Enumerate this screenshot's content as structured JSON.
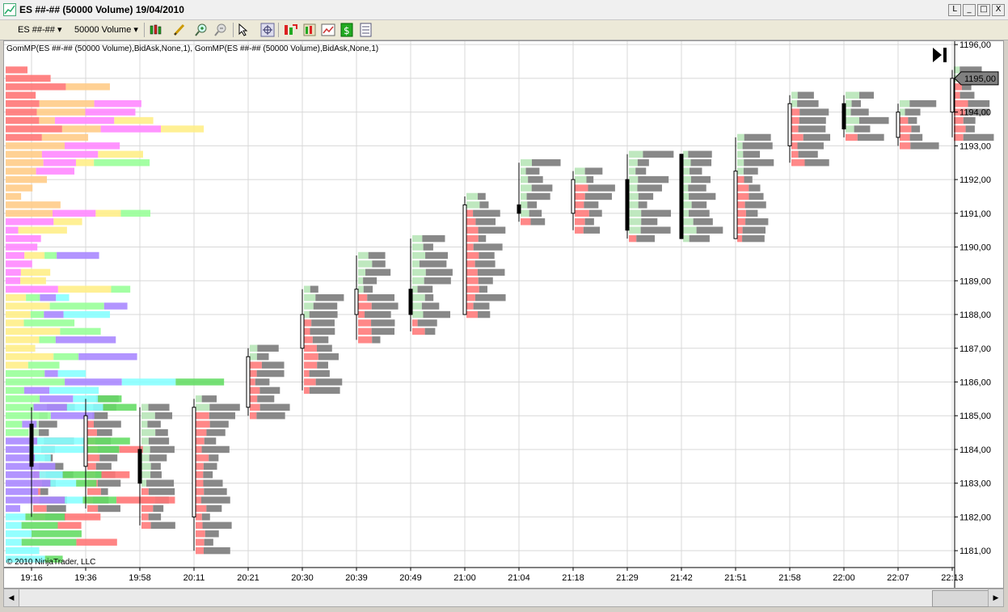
{
  "window": {
    "title": "ES ##-## (50000 Volume)  19/04/2010",
    "buttons": [
      "L",
      "_",
      "□",
      "X"
    ]
  },
  "toolbar": {
    "instrument": "ES ##-##",
    "period": "50000 Volume",
    "icons": [
      "bar-style-icon",
      "pencil-draw-icon",
      "zoom-in-icon",
      "zoom-out-icon",
      "pointer-icon",
      "crosshair-icon",
      "indicators-icon",
      "strategies-icon",
      "chart-properties-icon",
      "data-box-icon",
      "trade-icon"
    ]
  },
  "indicator_label": "GomMP(ES ##-## (50000 Volume),BidAsk,None,1), GomMP(ES ##-## (50000 Volume),BidAsk,None,1)",
  "copyright": "© 2010 NinjaTrader, LLC",
  "current_price_label": "1195,00",
  "chart_data": {
    "type": "candlestick-volume-profile",
    "y_ticks": [
      "1181,00",
      "1182,00",
      "1183,00",
      "1184,00",
      "1185,00",
      "1186,00",
      "1187,00",
      "1188,00",
      "1189,00",
      "1190,00",
      "1191,00",
      "1192,00",
      "1193,00",
      "1194,00",
      "1195,00",
      "1196,00"
    ],
    "ylim": [
      1180.5,
      1196.1
    ],
    "x_ticks": [
      "19:16",
      "19:36",
      "19:58",
      "20:11",
      "20:21",
      "20:30",
      "20:39",
      "20:49",
      "21:00",
      "21:04",
      "21:18",
      "21:29",
      "21:42",
      "21:51",
      "21:58",
      "22:00",
      "22:07",
      "22:13"
    ],
    "last_price": 1195.0,
    "bars": [
      {
        "time": "19:16",
        "open": 1184.75,
        "high": 1185.25,
        "low": 1182.0,
        "close": 1183.5
      },
      {
        "time": "19:36",
        "open": 1183.5,
        "high": 1185.5,
        "low": 1182.25,
        "close": 1185.0
      },
      {
        "time": "19:58",
        "open": 1184.0,
        "high": 1185.25,
        "low": 1181.75,
        "close": 1183.0
      },
      {
        "time": "20:11",
        "open": 1182.0,
        "high": 1185.5,
        "low": 1181.0,
        "close": 1185.25
      },
      {
        "time": "20:21",
        "open": 1185.25,
        "high": 1187.0,
        "low": 1185.0,
        "close": 1186.75
      },
      {
        "time": "20:30",
        "open": 1187.0,
        "high": 1188.75,
        "low": 1185.75,
        "close": 1188.0
      },
      {
        "time": "20:39",
        "open": 1188.0,
        "high": 1189.75,
        "low": 1187.25,
        "close": 1188.75
      },
      {
        "time": "20:49",
        "open": 1188.75,
        "high": 1190.25,
        "low": 1187.5,
        "close": 1188.0
      },
      {
        "time": "21:00",
        "open": 1188.0,
        "high": 1191.5,
        "low": 1188.0,
        "close": 1191.25
      },
      {
        "time": "21:04",
        "open": 1191.25,
        "high": 1192.5,
        "low": 1190.75,
        "close": 1191.0
      },
      {
        "time": "21:18",
        "open": 1191.0,
        "high": 1192.25,
        "low": 1190.5,
        "close": 1192.0
      },
      {
        "time": "21:29",
        "open": 1192.0,
        "high": 1192.75,
        "low": 1190.25,
        "close": 1190.5
      },
      {
        "time": "21:42",
        "open": 1192.75,
        "high": 1192.75,
        "low": 1190.25,
        "close": 1190.25
      },
      {
        "time": "21:51",
        "open": 1190.25,
        "high": 1193.25,
        "low": 1190.25,
        "close": 1192.25
      },
      {
        "time": "21:58",
        "open": 1193.0,
        "high": 1194.5,
        "low": 1192.5,
        "close": 1194.25
      },
      {
        "time": "22:00",
        "open": 1194.25,
        "high": 1194.5,
        "low": 1193.25,
        "close": 1193.5
      },
      {
        "time": "22:07",
        "open": 1193.25,
        "high": 1194.25,
        "low": 1193.0,
        "close": 1194.0
      },
      {
        "time": "22:13",
        "open": 1194.0,
        "high": 1195.25,
        "low": 1193.25,
        "close": 1195.0
      }
    ]
  }
}
